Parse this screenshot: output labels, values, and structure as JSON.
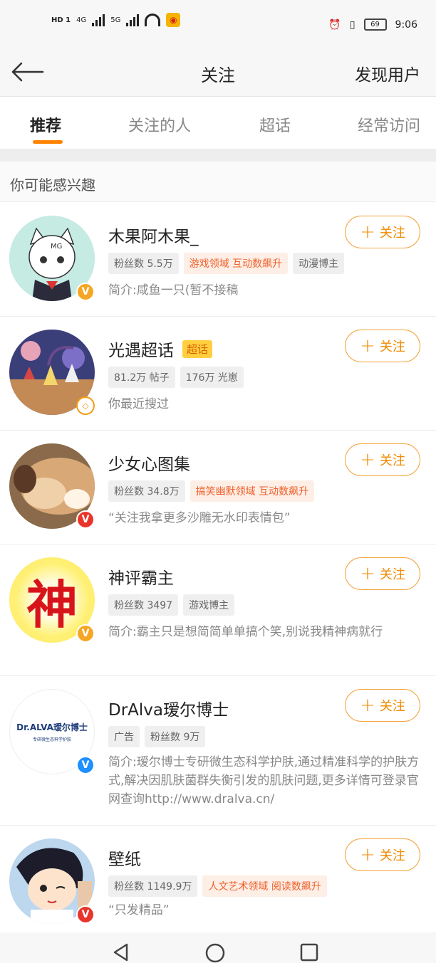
{
  "status_bar": {
    "left_labels": [
      "HD 1",
      "4G",
      "5G"
    ],
    "battery": "69",
    "time": "9:06",
    "weibo_icon": "weibo-notification-icon"
  },
  "nav": {
    "title": "关注",
    "discover_label": "发现用户",
    "back_icon": "back-arrow-icon"
  },
  "tabs": [
    {
      "label": "推荐",
      "active": true
    },
    {
      "label": "关注的人",
      "active": false
    },
    {
      "label": "超话",
      "active": false
    },
    {
      "label": "经常访问",
      "active": false
    }
  ],
  "section_header": "你可能感兴趣",
  "follow_label": "关注",
  "users": [
    {
      "name": "木果阿木果_",
      "tags": [
        {
          "text": "粉丝数 5.5万",
          "style": "gray"
        },
        {
          "text": "游戏领域 互动数飙升",
          "style": "orange"
        },
        {
          "text": "动漫博主",
          "style": "gray"
        }
      ],
      "intro": "简介:咸鱼一只(暂不接稿",
      "badge": "v-yellow"
    },
    {
      "name": "光遇超话",
      "super_tag": "超话",
      "tags": [
        {
          "text": "81.2万 帖子",
          "style": "gray"
        },
        {
          "text": "176万 光崽",
          "style": "gray"
        }
      ],
      "intro": "你最近搜过",
      "badge": "super-topic-diamond"
    },
    {
      "name": "少女心图集",
      "tags": [
        {
          "text": "粉丝数 34.8万",
          "style": "gray"
        },
        {
          "text": "搞笑幽默领域 互动数飙升",
          "style": "orange"
        }
      ],
      "intro": "“关注我拿更多沙雕无水印表情包”",
      "badge": "v-red"
    },
    {
      "name": "神评霸主",
      "tags": [
        {
          "text": "粉丝数 3497",
          "style": "gray"
        },
        {
          "text": "游戏博主",
          "style": "gray"
        }
      ],
      "intro": "简介:霸主只是想简简单单搞个笑,别说我精神病就行",
      "badge": "v-yellow",
      "avatar_char": "神"
    },
    {
      "name": "DrAlva瑷尔博士",
      "tags": [
        {
          "text": "广告",
          "style": "gray"
        },
        {
          "text": "粉丝数 9万",
          "style": "gray"
        }
      ],
      "intro": "简介:瑷尔博士专研微生态科学护肤,通过精准科学的护肤方式,解决因肌肤菌群失衡引发的肌肤问题,更多详情可登录官网查询http://www.dralva.cn/",
      "badge": "v-blue",
      "avatar_logo": "Dr.ALVA瑷尔博士",
      "avatar_sub": "专研微生态科学护肤"
    },
    {
      "name": "壁纸",
      "tags": [
        {
          "text": "粉丝数 1149.9万",
          "style": "gray"
        },
        {
          "text": "人文艺术领域 阅读数飙升",
          "style": "orange"
        }
      ],
      "intro": "“只发精品”",
      "badge": "v-red"
    }
  ],
  "colors": {
    "accent": "#ff8200",
    "follow_border": "#f5a23c",
    "tag_orange_text": "#f0612a",
    "tag_orange_bg": "#fdeee6"
  },
  "system_nav": [
    "back-triangle-icon",
    "home-circle-icon",
    "recents-square-icon"
  ]
}
